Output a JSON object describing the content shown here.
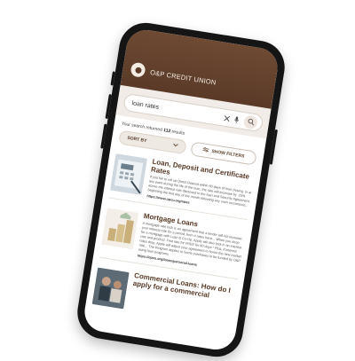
{
  "app": {
    "brand_name": "O&P CREDIT UNION"
  },
  "search": {
    "query": "loan rates"
  },
  "results": {
    "summary_prefix": "Your search returned ",
    "count": "112",
    "summary_suffix": " results",
    "sort_label": "SORT BY",
    "filters_label": "SHOW FILTERS"
  },
  "items": [
    {
      "title": "Loan, Deposit and Certificate Rates",
      "snippet": "If you fail to roll up Direct Deposit within 60 days of loan closing, or at any point during the life of the loan, the rate will increase by .25% above the interest rate disclosed in the loan and Security Agreement, beginning the first day of the month following any such occurrence...",
      "url": "https://www.opcu.org/rates"
    },
    {
      "title": "Mortgage Loans",
      "snippet": "A mortgage rate lock is an agreement that a lender will not increase your interest rate for a period, from 4 rates have... When you shop for a mortgage with Loan & Co-Op, Apple will also lock in an interest rate and product. First rate for FREE for 60 days * Plus, if interest rates drop, Apple will adjust your agreement to honor the new market rate... The Program applies to home purchases to be funded by O&P using loan programs",
      "url": "https://opcu.org/loans/personal-loans"
    },
    {
      "title": "Commercial Loans: How do I apply for a commercial",
      "snippet": "",
      "url": ""
    }
  ],
  "colors": {
    "brand_brown": "#5a3a27",
    "accent_cream": "#f5ece4"
  },
  "icons": [
    "logo-ring-icon",
    "clear-icon",
    "microphone-icon",
    "search-icon",
    "chevron-down-icon",
    "filter-sliders-icon"
  ]
}
